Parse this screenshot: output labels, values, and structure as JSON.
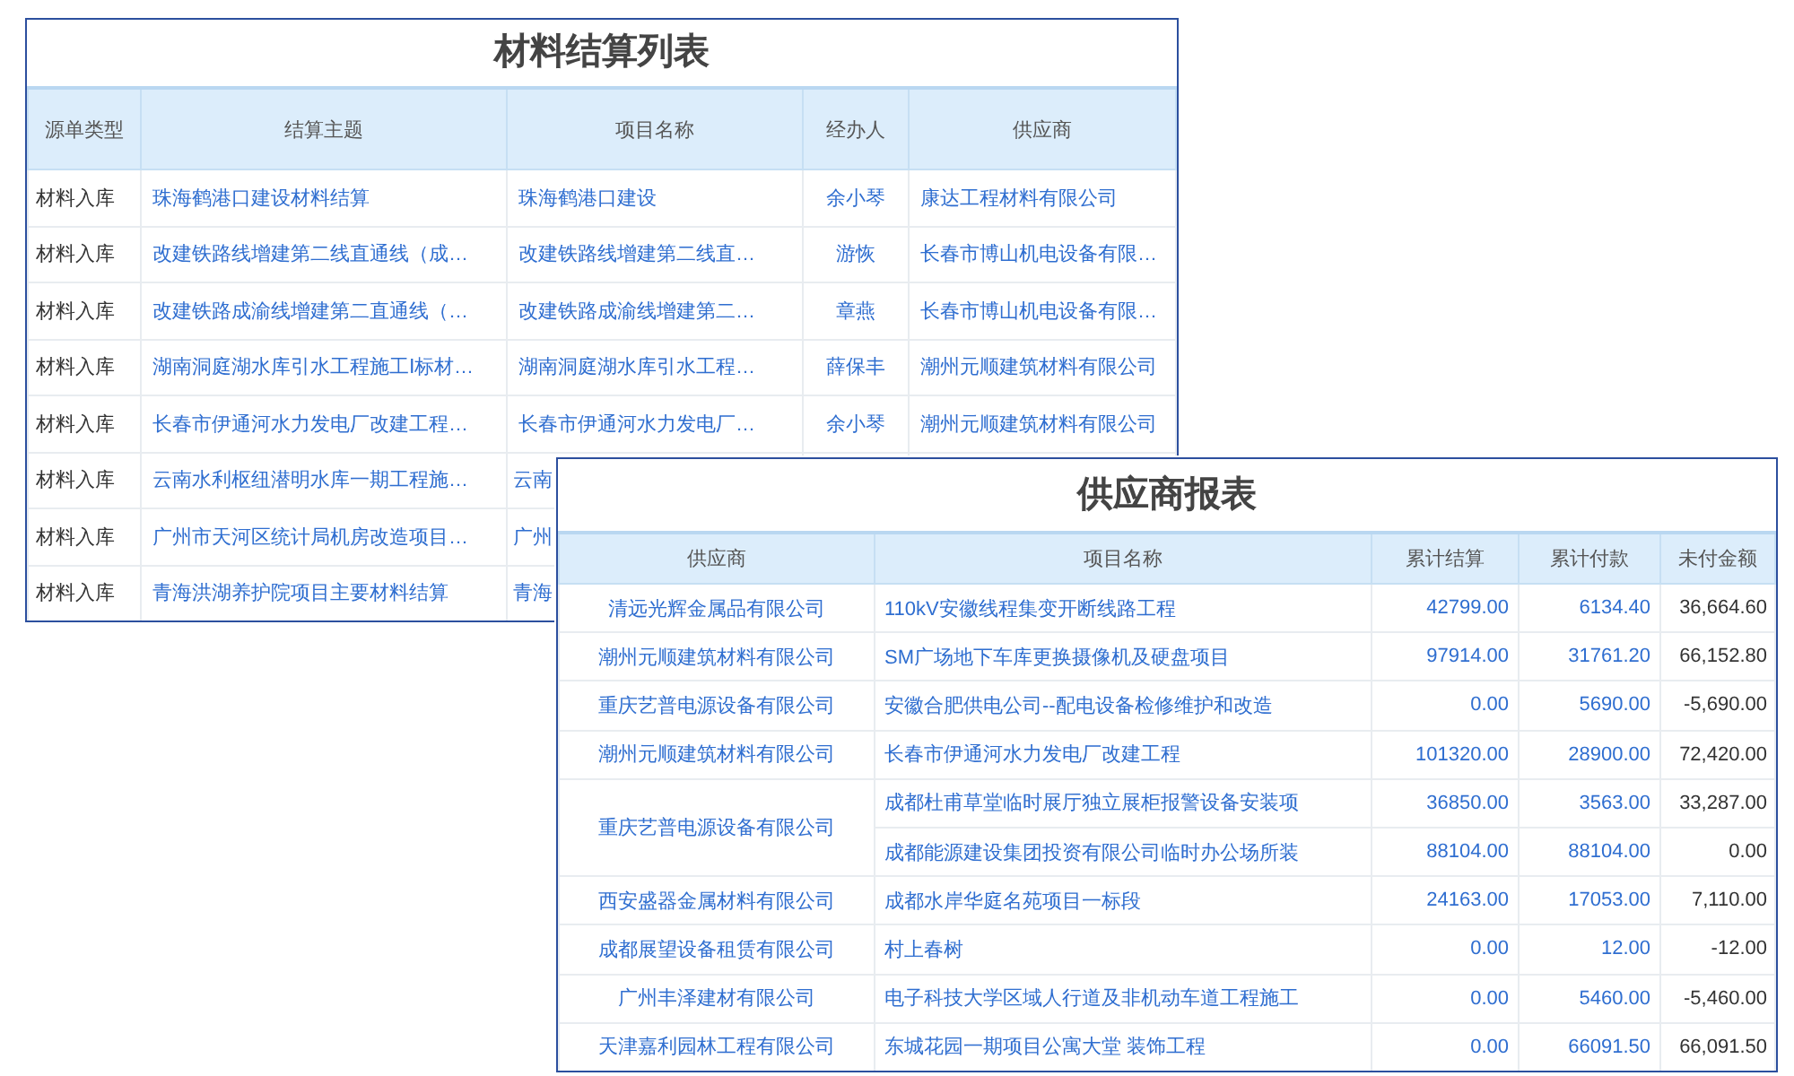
{
  "settlement_list": {
    "title": "材料结算列表",
    "columns": [
      "源单类型",
      "结算主题",
      "项目名称",
      "经办人",
      "供应商"
    ],
    "rows": [
      {
        "type": "材料入库",
        "subject": "珠海鹤港口建设材料结算",
        "project": "珠海鹤港口建设",
        "handler": "余小琴",
        "supplier": "康达工程材料有限公司"
      },
      {
        "type": "材料入库",
        "subject": "改建铁路线增建第二线直通线（成…",
        "project": "改建铁路线增建第二线直…",
        "handler": "游恢",
        "supplier": "长春市博山机电设备有限…"
      },
      {
        "type": "材料入库",
        "subject": "改建铁路成渝线增建第二直通线（…",
        "project": "改建铁路成渝线增建第二…",
        "handler": "章燕",
        "supplier": "长春市博山机电设备有限…"
      },
      {
        "type": "材料入库",
        "subject": "湖南洞庭湖水库引水工程施工Ⅰ标材…",
        "project": "湖南洞庭湖水库引水工程…",
        "handler": "薛保丰",
        "supplier": "潮州元顺建筑材料有限公司"
      },
      {
        "type": "材料入库",
        "subject": "长春市伊通河水力发电厂改建工程…",
        "project": "长春市伊通河水力发电厂…",
        "handler": "余小琴",
        "supplier": "潮州元顺建筑材料有限公司"
      },
      {
        "type": "材料入库",
        "subject": "云南水利枢纽潜明水库一期工程施…",
        "project": "云南"
      },
      {
        "type": "材料入库",
        "subject": "广州市天河区统计局机房改造项目…",
        "project": "广州"
      },
      {
        "type": "材料入库",
        "subject": "青海洪湖养护院项目主要材料结算",
        "project": "青海"
      }
    ]
  },
  "supplier_report": {
    "title": "供应商报表",
    "columns": [
      "供应商",
      "项目名称",
      "累计结算",
      "累计付款",
      "未付金额"
    ],
    "groups": [
      {
        "supplier": "清远光辉金属品有限公司",
        "items": [
          {
            "project": "110kV安徽线程集变开断线路工程",
            "settled": "42799.00",
            "paid": "6134.40",
            "unpaid": "36,664.60"
          }
        ]
      },
      {
        "supplier": "潮州元顺建筑材料有限公司",
        "items": [
          {
            "project": "SM广场地下车库更换摄像机及硬盘项目",
            "settled": "97914.00",
            "paid": "31761.20",
            "unpaid": "66,152.80"
          }
        ]
      },
      {
        "supplier": "重庆艺普电源设备有限公司",
        "items": [
          {
            "project": "安徽合肥供电公司--配电设备检修维护和改造",
            "settled": "0.00",
            "paid": "5690.00",
            "unpaid": "-5,690.00"
          }
        ]
      },
      {
        "supplier": "潮州元顺建筑材料有限公司",
        "items": [
          {
            "project": "长春市伊通河水力发电厂改建工程",
            "settled": "101320.00",
            "paid": "28900.00",
            "unpaid": "72,420.00"
          }
        ]
      },
      {
        "supplier": "重庆艺普电源设备有限公司",
        "items": [
          {
            "project": "成都杜甫草堂临时展厅独立展柜报警设备安装项",
            "settled": "36850.00",
            "paid": "3563.00",
            "unpaid": "33,287.00"
          },
          {
            "project": "成都能源建设集团投资有限公司临时办公场所装",
            "settled": "88104.00",
            "paid": "88104.00",
            "unpaid": "0.00"
          }
        ]
      },
      {
        "supplier": "西安盛器金属材料有限公司",
        "items": [
          {
            "project": "成都水岸华庭名苑项目一标段",
            "settled": "24163.00",
            "paid": "17053.00",
            "unpaid": "7,110.00"
          }
        ]
      },
      {
        "supplier": "成都展望设备租赁有限公司",
        "items": [
          {
            "project": "村上春树",
            "settled": "0.00",
            "paid": "12.00",
            "unpaid": "-12.00"
          }
        ]
      },
      {
        "supplier": "广州丰泽建材有限公司",
        "items": [
          {
            "project": "电子科技大学区域人行道及非机动车道工程施工",
            "settled": "0.00",
            "paid": "5460.00",
            "unpaid": "-5,460.00"
          }
        ]
      },
      {
        "supplier": "天津嘉利园林工程有限公司",
        "items": [
          {
            "project": "东城花园一期项目公寓大堂 装饰工程",
            "settled": "0.00",
            "paid": "66091.50",
            "unpaid": "66,091.50"
          }
        ]
      }
    ]
  }
}
